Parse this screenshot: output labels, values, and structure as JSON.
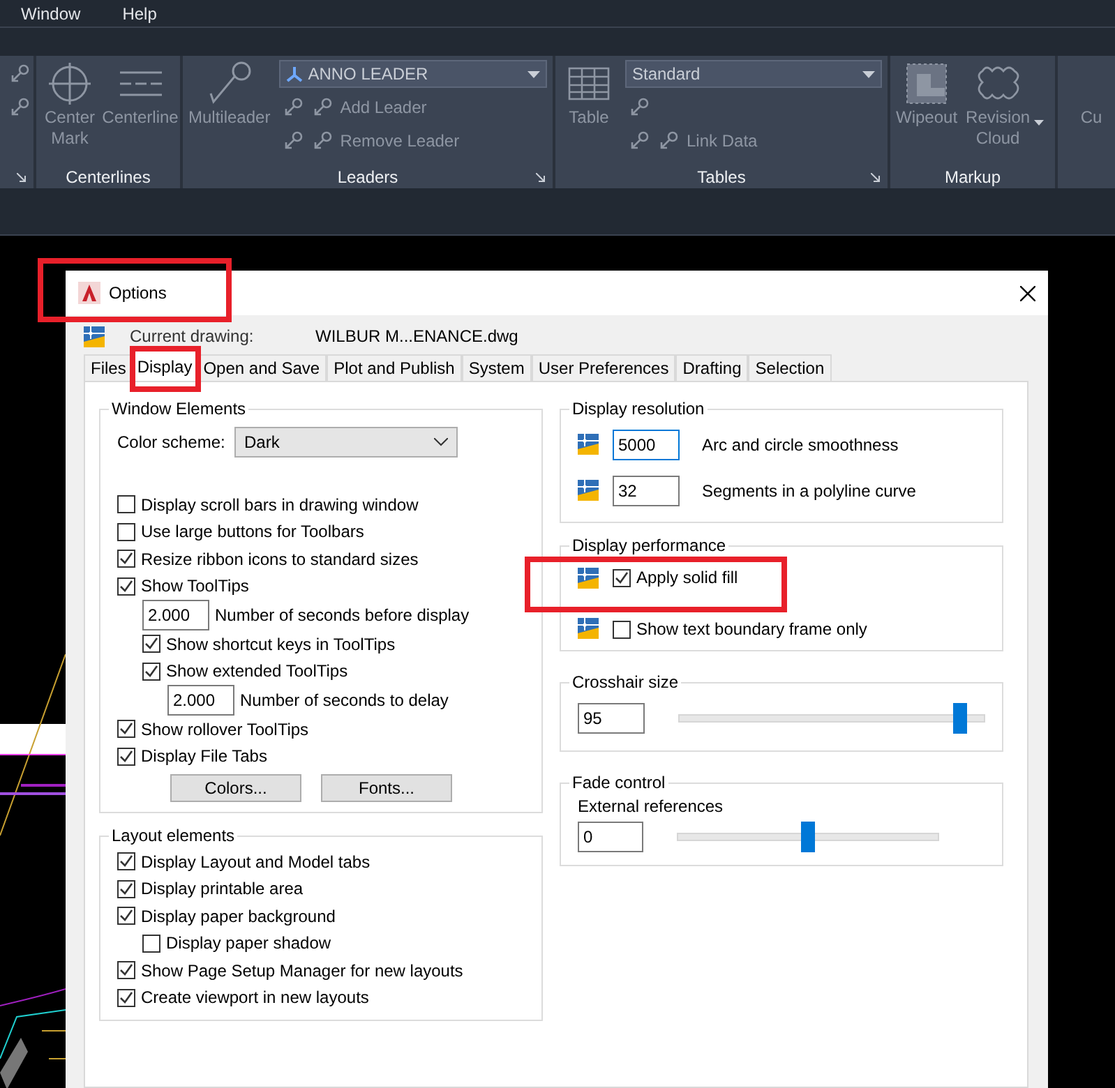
{
  "menu_bar": [
    "Window",
    "Help"
  ],
  "ribbon": {
    "panels": [
      {
        "launcher": true,
        "tools": [
          {
            "kind": "small"
          },
          {
            "kind": "small"
          }
        ]
      },
      {
        "title": "Centerlines",
        "launcher": false,
        "tools": [
          {
            "kind": "large",
            "label": "Center Mark"
          },
          {
            "kind": "large",
            "label": "Centerline"
          }
        ]
      },
      {
        "title": "Leaders",
        "launcher": true,
        "tools": [
          {
            "kind": "large",
            "label": "Multileader"
          },
          {
            "kind": "dropdown",
            "label": "ANNO LEADER"
          },
          {
            "kind": "small",
            "label": "Add Leader"
          },
          {
            "kind": "small",
            "label": "Remove Leader"
          }
        ]
      },
      {
        "title": "Tables",
        "launcher": true,
        "tools": [
          {
            "kind": "large",
            "label": "Table"
          },
          {
            "kind": "dropdown",
            "label": "Standard"
          },
          {
            "kind": "small"
          },
          {
            "kind": "small",
            "label": "Link Data"
          }
        ]
      },
      {
        "title": "Markup",
        "launcher": false,
        "tools": [
          {
            "kind": "large",
            "label": "Wipeout"
          },
          {
            "kind": "large",
            "label": "Revision Cloud",
            "menu": true
          }
        ]
      },
      {
        "launcher": false,
        "tools": [
          {
            "kind": "large",
            "label": "Cu"
          }
        ]
      }
    ]
  },
  "dialog": {
    "title": "Options",
    "highlight": true,
    "current_drawing_label": "Current drawing:",
    "current_drawing": "WILBUR M...ENANCE.dwg",
    "tabs": [
      {
        "label": "Files",
        "selected": false,
        "highlight": false
      },
      {
        "label": "Display",
        "selected": true,
        "highlight": true
      },
      {
        "label": "Open and Save",
        "selected": false,
        "highlight": false
      },
      {
        "label": "Plot and Publish",
        "selected": false,
        "highlight": false
      },
      {
        "label": "System",
        "selected": false,
        "highlight": false
      },
      {
        "label": "User Preferences",
        "selected": false,
        "highlight": false
      },
      {
        "label": "Drafting",
        "selected": false,
        "highlight": false
      },
      {
        "label": "Selection",
        "selected": false,
        "highlight": false
      }
    ],
    "window_elements": {
      "title": "Window Elements",
      "color_scheme_label": "Color scheme:",
      "color_scheme": "Dark",
      "options": [
        {
          "kind": "check",
          "label": "Display scroll bars in drawing window",
          "checked": false
        },
        {
          "kind": "check",
          "label": "Use large buttons for Toolbars",
          "checked": false
        },
        {
          "kind": "check",
          "label": "Resize ribbon icons to standard sizes",
          "checked": true
        },
        {
          "kind": "check",
          "label": "Show ToolTips",
          "checked": true,
          "children": [
            {
              "kind": "number",
              "value": "2.000",
              "label": "Number of seconds before display"
            },
            {
              "kind": "check",
              "label": "Show shortcut keys in ToolTips",
              "checked": true
            },
            {
              "kind": "check",
              "label": "Show extended ToolTips",
              "checked": true,
              "children": [
                {
                  "kind": "number",
                  "value": "2.000",
                  "label": "Number of seconds to delay"
                }
              ]
            }
          ]
        },
        {
          "kind": "check",
          "label": "Show rollover ToolTips",
          "checked": true
        },
        {
          "kind": "check",
          "label": "Display File Tabs",
          "checked": true
        }
      ],
      "buttons": [
        "Colors...",
        "Fonts..."
      ]
    },
    "layout_elements": {
      "title": "Layout elements",
      "options": [
        {
          "kind": "check",
          "label": "Display Layout and Model tabs",
          "checked": true
        },
        {
          "kind": "check",
          "label": "Display printable area",
          "checked": true
        },
        {
          "kind": "check",
          "label": "Display paper background",
          "checked": true,
          "children": [
            {
              "kind": "check",
              "label": "Display paper shadow",
              "checked": false
            }
          ]
        },
        {
          "kind": "check",
          "label": "Show Page Setup Manager for new layouts",
          "checked": true
        },
        {
          "kind": "check",
          "label": "Create viewport in new layouts",
          "checked": true
        }
      ]
    },
    "display_resolution": {
      "title": "Display resolution",
      "items": [
        {
          "value": "5000",
          "label": "Arc and circle smoothness",
          "focused": true
        },
        {
          "value": "32",
          "label": "Segments in a polyline curve",
          "focused": false
        }
      ]
    },
    "display_performance": {
      "title": "Display performance",
      "items": [
        {
          "label": "Apply solid fill",
          "checked": true,
          "highlight": true
        },
        {
          "label": "Show text boundary frame only",
          "checked": false,
          "highlight": false
        }
      ]
    },
    "crosshair": {
      "title": "Crosshair size",
      "value": "95",
      "level": 0.92
    },
    "fade": {
      "title": "Fade control",
      "label": "External references",
      "value": "0",
      "level": 0.5
    }
  }
}
